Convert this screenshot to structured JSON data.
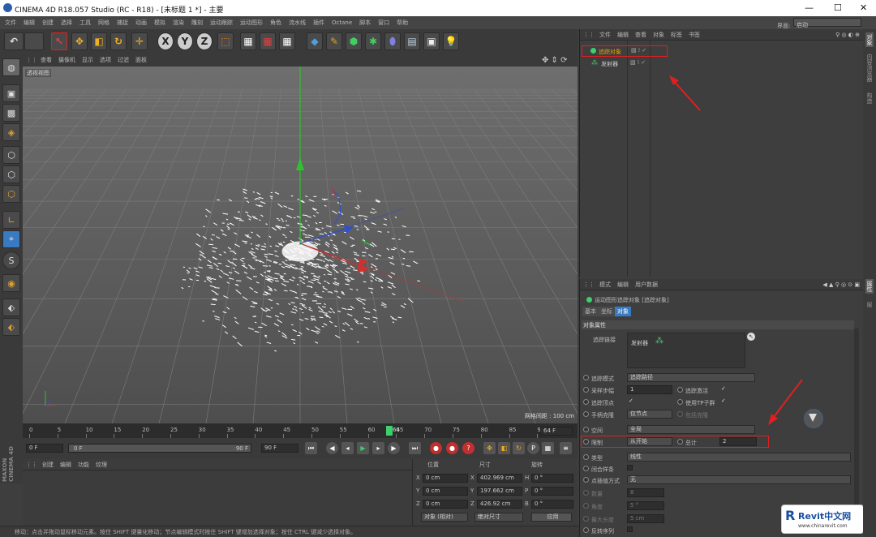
{
  "window": {
    "title": "CINEMA 4D R18.057 Studio (RC - R18) - [未标题 1 *] - 主要",
    "layout_label": "界面:",
    "layout_value": "启动"
  },
  "menu": [
    "文件",
    "编辑",
    "创建",
    "选择",
    "工具",
    "网格",
    "捕捉",
    "动画",
    "模拟",
    "渲染",
    "雕刻",
    "运动跟踪",
    "运动图形",
    "角色",
    "流水线",
    "插件",
    "Octane",
    "脚本",
    "窗口",
    "帮助"
  ],
  "viewport": {
    "menu": [
      "查看",
      "摄像机",
      "显示",
      "选项",
      "过滤",
      "面板"
    ],
    "view_name": "透视视图",
    "grid_spacing": "网格间距 : 100 cm"
  },
  "timeline": {
    "ticks": [
      "0",
      "5",
      "10",
      "15",
      "20",
      "25",
      "30",
      "35",
      "40",
      "45",
      "50",
      "55",
      "60",
      "65",
      "70",
      "75",
      "80",
      "85",
      "90"
    ],
    "current_frame": "64",
    "frame_display": "64 F"
  },
  "transport": {
    "start": "0 F",
    "range_start": "0 F",
    "range_end": "90 F",
    "end": "90 F"
  },
  "material_menu": [
    "创建",
    "编辑",
    "功能",
    "纹理"
  ],
  "coords": {
    "headers": {
      "pos": "位置",
      "size": "尺寸",
      "rot": "旋转"
    },
    "rows": [
      {
        "axis": "X",
        "pos": "0 cm",
        "saxis": "X",
        "size": "402.969 cm",
        "raxis": "H",
        "rot": "0 °"
      },
      {
        "axis": "Y",
        "pos": "0 cm",
        "saxis": "Y",
        "size": "197.662 cm",
        "raxis": "P",
        "rot": "0 °"
      },
      {
        "axis": "Z",
        "pos": "0 cm",
        "saxis": "Z",
        "size": "426.92 cm",
        "raxis": "B",
        "rot": "0 °"
      }
    ],
    "mode": "对象 (相对)",
    "size_mode": "绝对尺寸",
    "apply": "应用"
  },
  "status": "移动：点击并拖动鼠标移动元素。按住 SHIFT 键量化移动；节点编辑模式时按住 SHIFT 键增加选择对象；按住 CTRL 键减少选择对象。",
  "objects": {
    "menu": [
      "文件",
      "编辑",
      "查看",
      "对象",
      "标签",
      "书签"
    ],
    "items": [
      {
        "name": "追踪对象",
        "selected": true
      },
      {
        "name": "发射器",
        "selected": false
      }
    ]
  },
  "attributes": {
    "menu": [
      "模式",
      "编辑",
      "用户数据"
    ],
    "header": "运动图形追踪对象 [追踪对象]",
    "tabs": [
      "基本",
      "坐标",
      "对象"
    ],
    "active_tab": "对象",
    "section": "对象属性",
    "trace_link_label": "追踪链接",
    "trace_link_item": "发射器",
    "trace_mode_label": "追踪模式",
    "trace_mode_value": "追踪路径",
    "sample_step_label": "采样步幅",
    "sample_step_value": "1",
    "trace_active_label": "追踪激活",
    "trace_vertex_label": "追踪顶点",
    "use_tp_label": "使用TP子群",
    "handle_clone_label": "手柄克隆",
    "handle_clone_value": "仅节点",
    "include_clones_label": "包括克隆",
    "space_label": "空间",
    "space_value": "全局",
    "limit_label": "限制",
    "limit_value": "从开始",
    "total_label": "总计",
    "total_value": "2",
    "type_label": "类型",
    "type_value": "线性",
    "closed_label": "闭合样条",
    "interp_label": "点插值方式",
    "interp_value": "无",
    "count_label": "数量",
    "count_value": "8",
    "angle_label": "角度",
    "angle_value": "5 °",
    "maxlen_label": "最大长度",
    "maxlen_value": "5 cm",
    "reverse_label": "反转序列"
  },
  "right_tabs": [
    "对象",
    "内容浏览器",
    "构造",
    "属性",
    "层"
  ],
  "watermark": {
    "brand": "Revit中文网",
    "url": "www.chinarevit.com"
  },
  "colors": {
    "selected_orange": "#f0a000",
    "x_axis": "#d03030",
    "y_axis": "#30c030",
    "z_axis": "#3050d0",
    "annotation_red": "#e02020",
    "timeline_marker": "#3ccf6a"
  }
}
